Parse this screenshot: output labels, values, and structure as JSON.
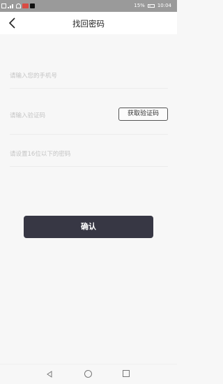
{
  "status_bar": {
    "battery_text": "15%",
    "time": "10:04",
    "icons": [
      "sim-icon",
      "signal-icon",
      "wifi-icon",
      "notification-red-icon",
      "tiktok-icon",
      "battery-icon"
    ]
  },
  "header": {
    "title": "找回密码",
    "back_icon": "chevron-left-icon"
  },
  "form": {
    "phone_placeholder": "请输入您的手机号",
    "code_placeholder": "请输入验证码",
    "get_code_label": "获取验证码",
    "password_placeholder": "请设置16位以下的密码",
    "confirm_label": "确认"
  },
  "colors": {
    "accent": "#373744",
    "background": "#f7f7f7",
    "placeholder": "#c4c4c4"
  },
  "nav": {
    "icons": [
      "back-triangle-icon",
      "home-circle-icon",
      "recent-square-icon"
    ]
  }
}
